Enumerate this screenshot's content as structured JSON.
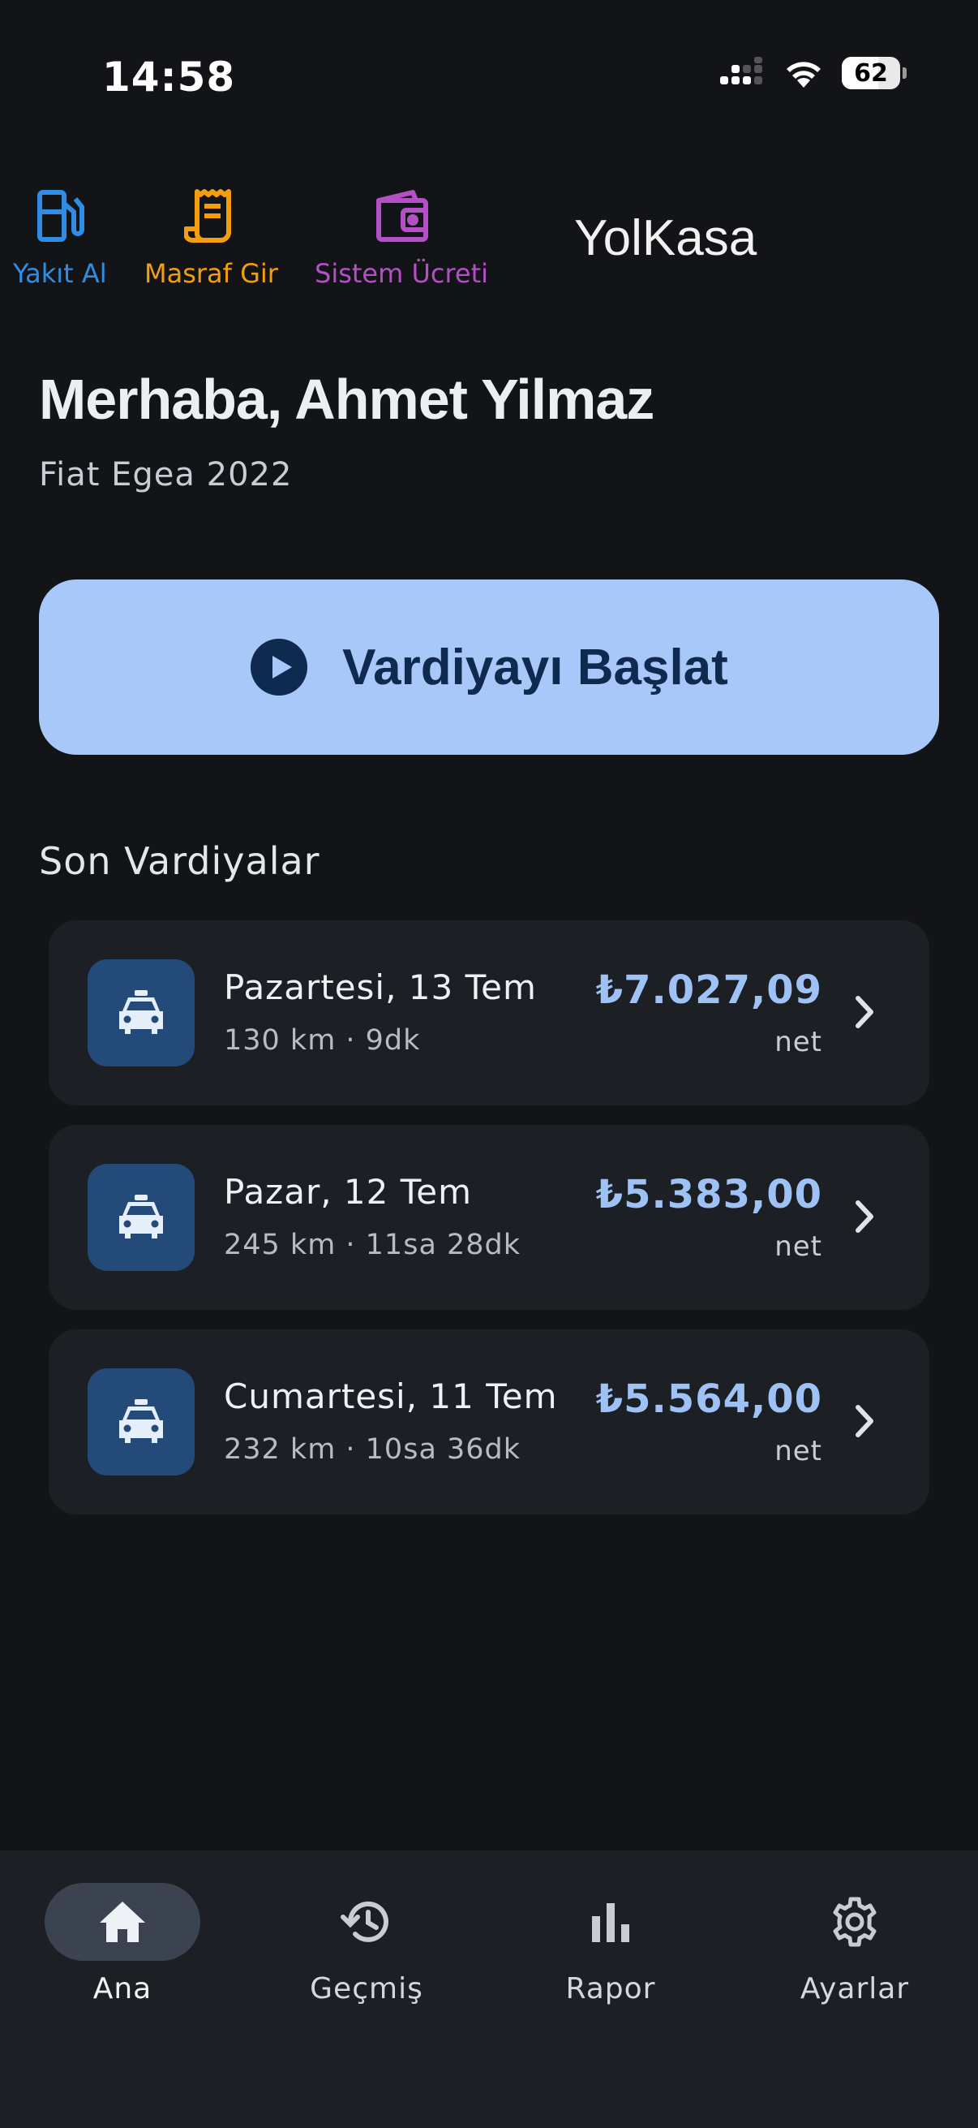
{
  "status_bar": {
    "time": "14:58",
    "battery_percent": "62",
    "battery_level": 0.62
  },
  "quick_actions": [
    {
      "label": "Yakıt Al",
      "icon": "fuel-pump-icon",
      "color": "#2f8de4"
    },
    {
      "label": "Masraf Gir",
      "icon": "receipt-icon",
      "color": "#f59e0b"
    },
    {
      "label": "Sistem Ücreti",
      "icon": "wallet-icon",
      "color": "#b44fc6"
    }
  ],
  "brand": "YolKasa",
  "greeting": "Merhaba, Ahmet Yilmaz",
  "car_model": "Fiat Egea 2022",
  "start_shift": {
    "label": "Vardiyayı Başlat",
    "icon": "play-circle-icon"
  },
  "recent_shifts": {
    "title": "Son Vardiyalar",
    "items": [
      {
        "title": "Pazartesi, 13 Tem",
        "details": "130 km · 9dk",
        "amount": "₺7.027,09",
        "amount_label": "net",
        "icon": "taxi-icon"
      },
      {
        "title": "Pazar, 12 Tem",
        "details": "245 km · 11sa 28dk",
        "amount": "₺5.383,00",
        "amount_label": "net",
        "icon": "taxi-icon"
      },
      {
        "title": "Cumartesi, 11 Tem",
        "details": "232 km · 10sa 36dk",
        "amount": "₺5.564,00",
        "amount_label": "net",
        "icon": "taxi-icon"
      }
    ]
  },
  "bottom_nav": [
    {
      "label": "Ana",
      "icon": "home-icon",
      "active": true
    },
    {
      "label": "Geçmiş",
      "icon": "history-icon",
      "active": false
    },
    {
      "label": "Rapor",
      "icon": "bar-chart-icon",
      "active": false
    },
    {
      "label": "Ayarlar",
      "icon": "settings-gear-icon",
      "active": false
    }
  ],
  "colors": {
    "background": "#121418",
    "card": "#1c1f24",
    "accent": "#a8c8fa",
    "amount": "#9fc2f6"
  }
}
